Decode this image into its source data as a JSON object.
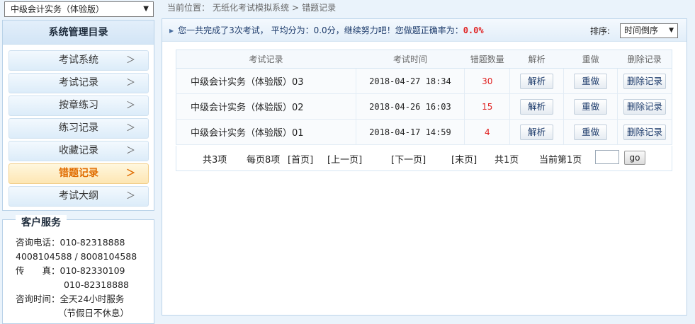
{
  "subject_select": {
    "value": "中级会计实务（体验版）",
    "arrow": "▼"
  },
  "nav": {
    "title": "系统管理目录",
    "items": [
      {
        "label": "考试系统",
        "active": false
      },
      {
        "label": "考试记录",
        "active": false
      },
      {
        "label": "按章练习",
        "active": false
      },
      {
        "label": "练习记录",
        "active": false
      },
      {
        "label": "收藏记录",
        "active": false
      },
      {
        "label": "错题记录",
        "active": true
      },
      {
        "label": "考试大纲",
        "active": false
      }
    ],
    "chevron": "＞"
  },
  "service": {
    "title": "客户服务",
    "phone_label": "咨询电话：",
    "phone1": "010-82318888",
    "phone2": "4008104588 / 8008104588",
    "fax_label": "传　　真：",
    "fax1": "010-82330109",
    "fax2": "010-82318888",
    "hours_label": "咨询时间：",
    "hours": "全天24小时服务",
    "holiday": "（节假日不休息）"
  },
  "breadcrumb": {
    "prefix": "当前位置：",
    "root": "无纸化考试模拟系统",
    "sep": ">",
    "current": "错题记录"
  },
  "summary": {
    "pre": "您一共完成了3次考试， 平均分为：0.0分，继续努力吧！您做题正确率为：",
    "rate": "0.0%"
  },
  "sort": {
    "label": "排序:",
    "value": "时间倒序",
    "arrow": "▼"
  },
  "table": {
    "headers": [
      "考试记录",
      "考试时间",
      "错题数量",
      "解析",
      "重做",
      "删除记录"
    ],
    "rows": [
      {
        "name": "中级会计实务（体验版）03",
        "time": "2018-04-27 18:34",
        "count": "30",
        "analyze": "解析",
        "redo": "重做",
        "delete": "删除记录"
      },
      {
        "name": "中级会计实务（体验版）02",
        "time": "2018-04-26 16:03",
        "count": "15",
        "analyze": "解析",
        "redo": "重做",
        "delete": "删除记录"
      },
      {
        "name": "中级会计实务（体验版）01",
        "time": "2018-04-17 14:59",
        "count": "4",
        "analyze": "解析",
        "redo": "重做",
        "delete": "删除记录"
      }
    ]
  },
  "pager": {
    "total": "共3项",
    "per_page": "每页8项",
    "first": "[首页]",
    "prev": "[上一页]",
    "next": "[下一页]",
    "last": "[末页]",
    "pages": "共1页",
    "current": "当前第1页",
    "go": "go",
    "input_value": ""
  }
}
